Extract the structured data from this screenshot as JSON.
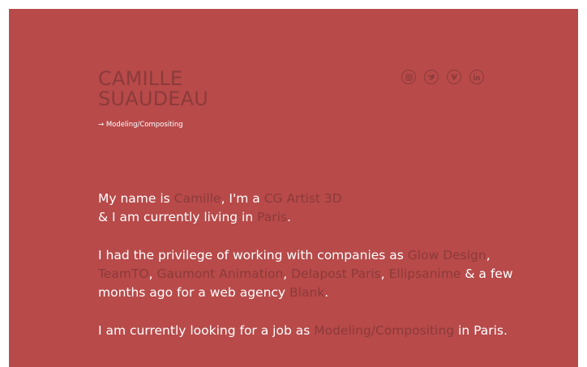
{
  "header": {
    "name_line1": "CAMILLE",
    "name_line2": "SUAUDEAU",
    "role_arrow": "→",
    "role_label": "Modeling/Compositing"
  },
  "socials": [
    {
      "icon": "instagram-icon"
    },
    {
      "icon": "twitter-icon"
    },
    {
      "icon": "vimeo-icon"
    },
    {
      "icon": "linkedin-icon"
    }
  ],
  "bio": {
    "p1": {
      "t1": "My name is ",
      "l1": "Camille",
      "t2": ", I'm a ",
      "l2": "CG Artist 3D",
      "t3": "& I am currently living in ",
      "l3": "Paris",
      "t4": "."
    },
    "p2": {
      "t1": "I had the privilege of working with companies as ",
      "l1": "Glow Design",
      "t2": ",",
      "l2": "TeamTO",
      "t3": ", ",
      "l3": "Gaumont Animation",
      "t4": ", ",
      "l4": "Delapost Paris",
      "t5": ", ",
      "l5": "Ellipsanime",
      "t6": " & a few",
      "t7": "months ago for a web agency ",
      "l6": "Blank",
      "t8": "."
    },
    "p3": {
      "t1": "I am currently looking for a job as ",
      "l1": "Modeling/Compositing",
      "t2": " in Paris."
    }
  },
  "colors": {
    "background": "#b84a4a",
    "accent": "#8c3a3a",
    "text": "#ffffff"
  }
}
